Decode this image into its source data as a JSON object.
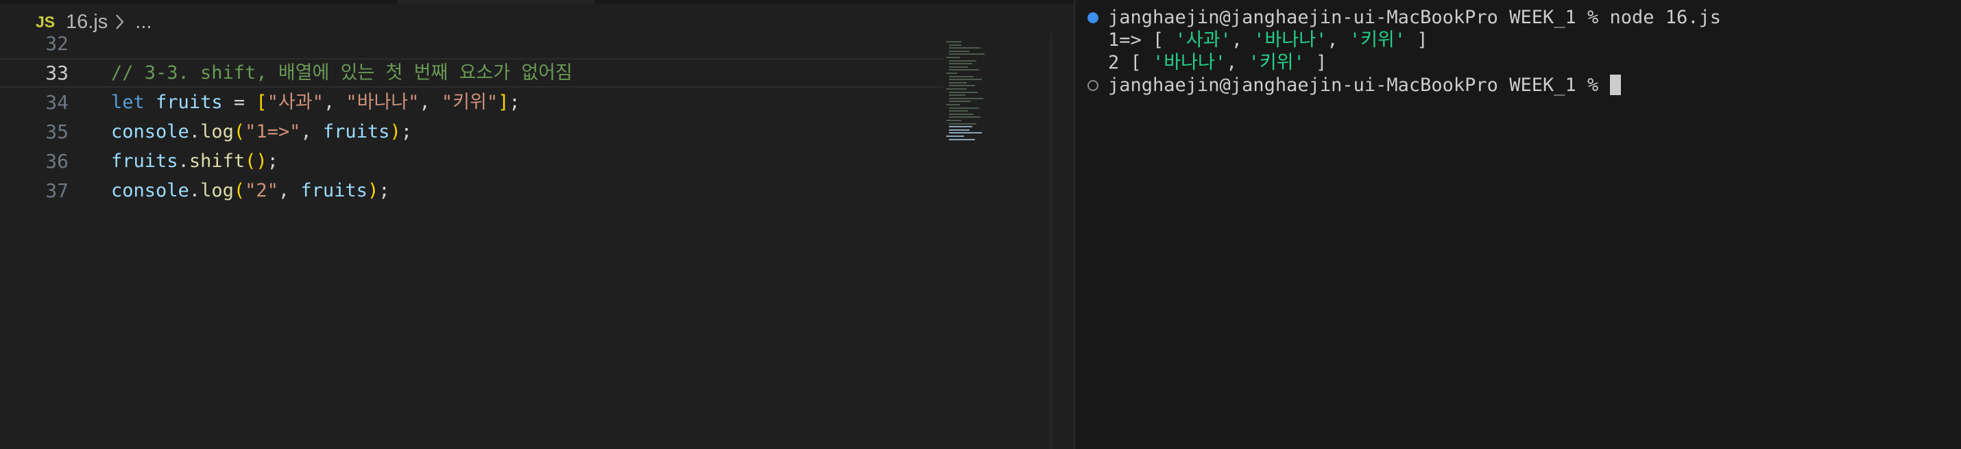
{
  "editor": {
    "breadcrumb": {
      "file_icon": "JS",
      "file_name": "16.js",
      "more": "..."
    },
    "lines": [
      {
        "number": "32",
        "code": []
      },
      {
        "number": "33",
        "active": true,
        "code": [
          {
            "t": "t-comment",
            "v": "// 3-3. shift, 배열에 있는 첫 번째 요소가 없어짐"
          }
        ]
      },
      {
        "number": "34",
        "code": [
          {
            "t": "t-kw",
            "v": "let"
          },
          {
            "t": "t-op",
            "v": " "
          },
          {
            "t": "t-var",
            "v": "fruits"
          },
          {
            "t": "t-op",
            "v": " = "
          },
          {
            "t": "t-br",
            "v": "["
          },
          {
            "t": "t-str",
            "v": "\"사과\""
          },
          {
            "t": "t-op",
            "v": ", "
          },
          {
            "t": "t-str",
            "v": "\"바나나\""
          },
          {
            "t": "t-op",
            "v": ", "
          },
          {
            "t": "t-str",
            "v": "\"키위\""
          },
          {
            "t": "t-br",
            "v": "]"
          },
          {
            "t": "t-op",
            "v": ";"
          }
        ]
      },
      {
        "number": "35",
        "code": [
          {
            "t": "t-var",
            "v": "console"
          },
          {
            "t": "t-op",
            "v": "."
          },
          {
            "t": "t-fn",
            "v": "log"
          },
          {
            "t": "t-br",
            "v": "("
          },
          {
            "t": "t-str",
            "v": "\"1=>\""
          },
          {
            "t": "t-op",
            "v": ", "
          },
          {
            "t": "t-var",
            "v": "fruits"
          },
          {
            "t": "t-br",
            "v": ")"
          },
          {
            "t": "t-op",
            "v": ";"
          }
        ]
      },
      {
        "number": "36",
        "code": [
          {
            "t": "t-var",
            "v": "fruits"
          },
          {
            "t": "t-op",
            "v": "."
          },
          {
            "t": "t-fn",
            "v": "shift"
          },
          {
            "t": "t-br",
            "v": "()"
          },
          {
            "t": "t-op",
            "v": ";"
          }
        ]
      },
      {
        "number": "37",
        "code": [
          {
            "t": "t-var",
            "v": "console"
          },
          {
            "t": "t-op",
            "v": "."
          },
          {
            "t": "t-fn",
            "v": "log"
          },
          {
            "t": "t-br",
            "v": "("
          },
          {
            "t": "t-str",
            "v": "\"2\""
          },
          {
            "t": "t-op",
            "v": ", "
          },
          {
            "t": "t-var",
            "v": "fruits"
          },
          {
            "t": "t-br",
            "v": ")"
          },
          {
            "t": "t-op",
            "v": ";"
          }
        ]
      }
    ]
  },
  "terminal": {
    "lines": [
      {
        "marker": "filled",
        "segments": [
          {
            "t": "",
            "v": "janghaejin@janghaejin-ui-MacBookPro WEEK_1 % node 16.js"
          }
        ]
      },
      {
        "marker": "",
        "segments": [
          {
            "t": "",
            "v": "1=> [ "
          },
          {
            "t": "t-green",
            "v": "'사과'"
          },
          {
            "t": "",
            "v": ", "
          },
          {
            "t": "t-green",
            "v": "'바나나'"
          },
          {
            "t": "",
            "v": ", "
          },
          {
            "t": "t-green",
            "v": "'키위'"
          },
          {
            "t": "",
            "v": " ]"
          }
        ]
      },
      {
        "marker": "",
        "segments": [
          {
            "t": "",
            "v": "2 [ "
          },
          {
            "t": "t-green",
            "v": "'바나나'"
          },
          {
            "t": "",
            "v": ", "
          },
          {
            "t": "t-green",
            "v": "'키위'"
          },
          {
            "t": "",
            "v": " ]"
          }
        ]
      },
      {
        "marker": "hollow",
        "cursor": true,
        "segments": [
          {
            "t": "",
            "v": "janghaejin@janghaejin-ui-MacBookPro WEEK_1 % "
          }
        ]
      }
    ]
  },
  "colors": {
    "editor_bg": "#1f1f1f",
    "terminal_bg": "#181818",
    "comment": "#6a9955",
    "keyword": "#569cd6",
    "variable": "#9cdcfe",
    "function": "#dcdcaa",
    "string": "#ce9178",
    "bracket": "#ffd700",
    "terminal_string": "#23d18b",
    "command_marker": "#3b8eea"
  }
}
